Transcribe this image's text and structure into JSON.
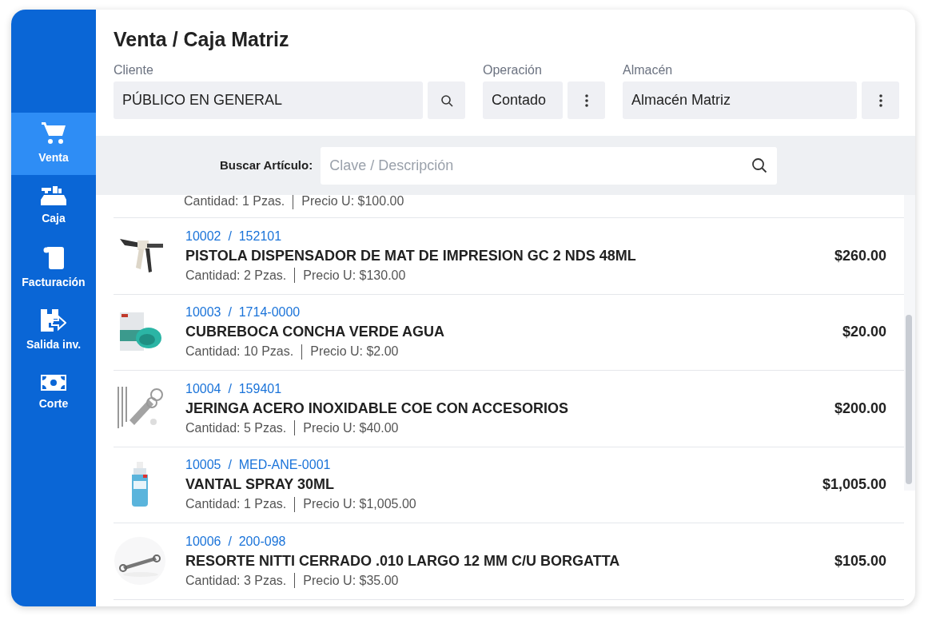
{
  "sidebar": {
    "items": [
      {
        "label": "Venta",
        "selected": true
      },
      {
        "label": "Caja",
        "selected": false
      },
      {
        "label": "Facturación",
        "selected": false
      },
      {
        "label": "Salida inv.",
        "selected": false
      },
      {
        "label": "Corte",
        "selected": false
      }
    ]
  },
  "header": {
    "title": "Venta / Caja Matriz"
  },
  "fields": {
    "client": {
      "label": "Cliente",
      "value": "PÚBLICO EN GENERAL"
    },
    "operation": {
      "label": "Operación",
      "value": "Contado"
    },
    "warehouse": {
      "label": "Almacén",
      "value": "Almacén Matriz"
    }
  },
  "search": {
    "label": "Buscar Artículo:",
    "placeholder": "Clave / Descripción"
  },
  "partial_row": {
    "quantity": "Cantidad: 1 Pzas.",
    "unit_price": "Precio U: $100.00"
  },
  "items": [
    {
      "code": "10002  /  152101",
      "name": "PISTOLA DISPENSADOR DE MAT DE IMPRESION GC 2 NDS 48ML",
      "quantity": "Cantidad: 2 Pzas.",
      "unit_price": "Precio U: $130.00",
      "total": "$260.00"
    },
    {
      "code": "10003  /  1714-0000",
      "name": "CUBREBOCA CONCHA VERDE AGUA",
      "quantity": "Cantidad: 10 Pzas.",
      "unit_price": "Precio U: $2.00",
      "total": "$20.00"
    },
    {
      "code": "10004  /  159401",
      "name": "JERINGA ACERO INOXIDABLE COE CON ACCESORIOS",
      "quantity": "Cantidad: 5 Pzas.",
      "unit_price": "Precio U: $40.00",
      "total": "$200.00"
    },
    {
      "code": "10005  /  MED-ANE-0001",
      "name": "VANTAL SPRAY 30ML",
      "quantity": "Cantidad: 1 Pzas.",
      "unit_price": "Precio U: $1,005.00",
      "total": "$1,005.00"
    },
    {
      "code": "10006  /  200-098",
      "name": "RESORTE NITTI CERRADO .010 LARGO 12 MM C/U BORGATTA",
      "quantity": "Cantidad: 3 Pzas.",
      "unit_price": "Precio U: $35.00",
      "total": "$105.00"
    }
  ]
}
